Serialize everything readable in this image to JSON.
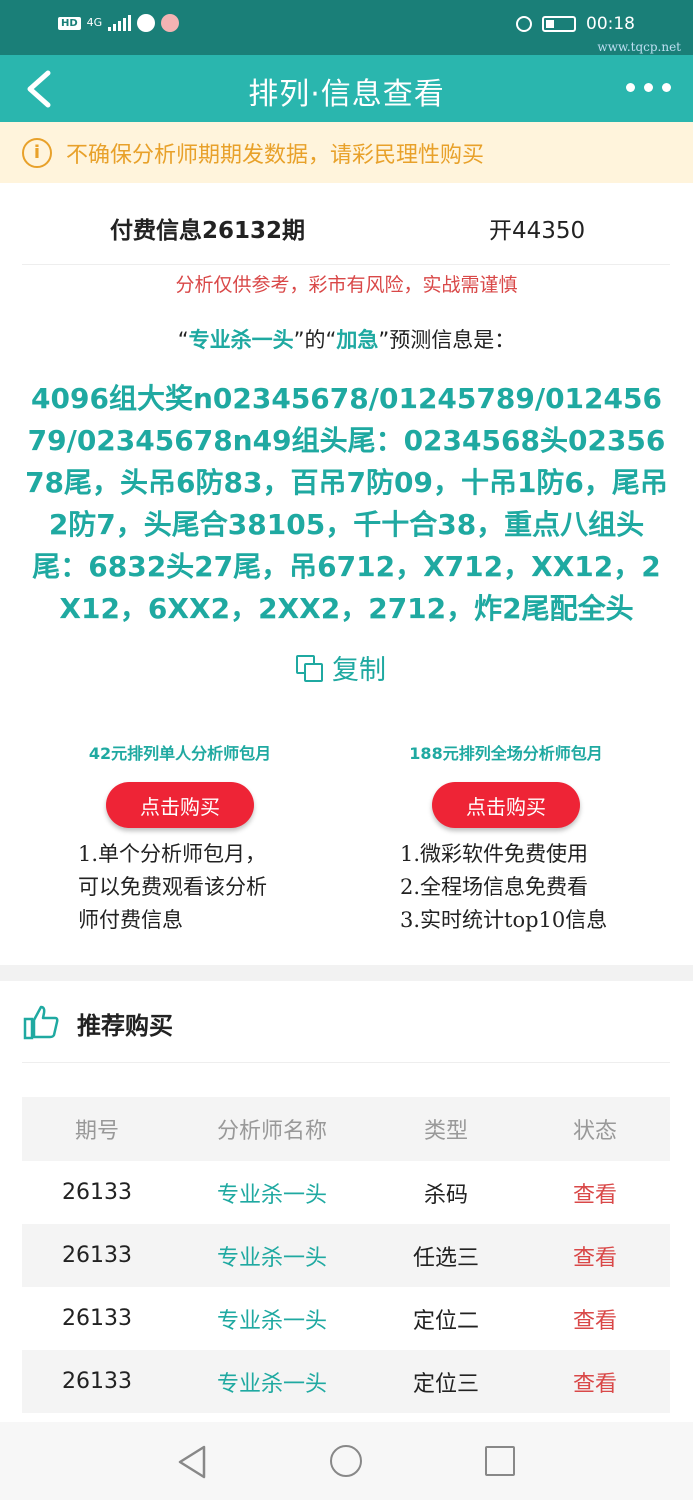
{
  "status_bar": {
    "hd": "HD",
    "net": "4G",
    "time": "00:18",
    "watermark": "www.tqcp.net"
  },
  "header": {
    "title": "排列·信息查看"
  },
  "notice": {
    "text": "不确保分析师期期发数据，请彩民理性购买"
  },
  "info": {
    "title": "付费信息26132期",
    "open_result": "开44350",
    "risk_text": "分析仅供参考，彩市有风险，实战需谨慎",
    "predict_q1": "“",
    "analyst": "专业杀一头",
    "predict_q2": "”的“",
    "category": "加急",
    "predict_q3": "”预测信息是：",
    "content": "4096组大奖n02345678/01245789/01245679/02345678n49组头尾：0234568头0235678尾，头吊6防83，百吊7防09，十吊1防6，尾吊2防7，头尾合38105，千十合38，重点八组头尾：6832头27尾，吊6712，X712，XX12，2X12，6XX2，2XX2，2712，炸2尾配全头",
    "copy_label": "复制"
  },
  "packages": [
    {
      "title": "42元排列单人分析师包月",
      "button": "点击购买",
      "items": [
        "1.单个分析师包月，",
        "可以免费观看该分析",
        "师付费信息"
      ]
    },
    {
      "title": "188元排列全场分析师包月",
      "button": "点击购买",
      "items": [
        "1.微彩软件免费使用",
        "2.全程场信息免费看",
        "3.实时统计top10信息"
      ]
    }
  ],
  "recommend": {
    "title": "推荐购买",
    "columns": [
      "期号",
      "分析师名称",
      "类型",
      "状态"
    ],
    "rows": [
      {
        "period": "26133",
        "analyst": "专业杀一头",
        "type": "杀码",
        "status": "查看"
      },
      {
        "period": "26133",
        "analyst": "专业杀一头",
        "type": "任选三",
        "status": "查看"
      },
      {
        "period": "26133",
        "analyst": "专业杀一头",
        "type": "定位二",
        "status": "查看"
      },
      {
        "period": "26133",
        "analyst": "专业杀一头",
        "type": "定位三",
        "status": "查看"
      }
    ]
  },
  "colors": {
    "status_bar": "#1a7f78",
    "title_bar": "#2ab6ae",
    "accent_teal": "#1fa9a1",
    "buy_red": "#ee2436",
    "notice_orange": "#e8a12a",
    "warn_red": "#d94848"
  }
}
